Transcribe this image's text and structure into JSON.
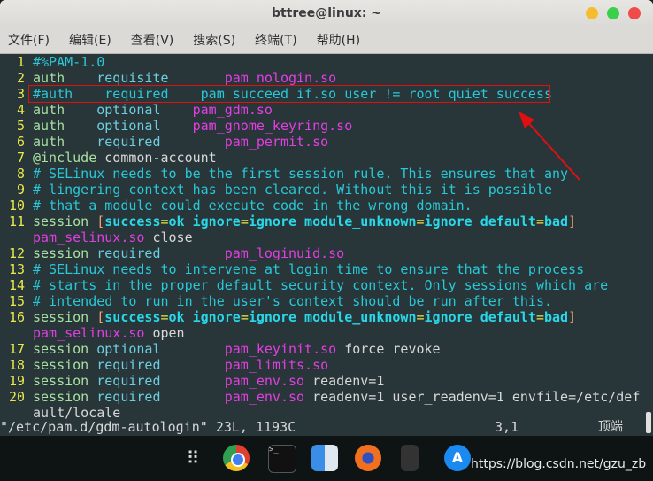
{
  "window": {
    "title": "bttree@linux: ~",
    "buttons": {
      "minimize": "#f5bd2e",
      "maximize": "#3ad04a",
      "close": "#f04a4a"
    }
  },
  "menu": [
    "文件(F)",
    "编辑(E)",
    "查看(V)",
    "搜索(S)",
    "终端(T)",
    "帮助(H)"
  ],
  "editor": {
    "rows": [
      {
        "num": "1",
        "segs": [
          [
            "c",
            "#%PAM-1.0"
          ]
        ]
      },
      {
        "num": "2",
        "segs": [
          [
            "k",
            "auth"
          ],
          [
            "p",
            "    "
          ],
          [
            "t",
            "requisite"
          ],
          [
            "p",
            "       "
          ],
          [
            "m",
            "pam_nologin.so"
          ]
        ]
      },
      {
        "num": "3",
        "segs": [
          [
            "c",
            "#auth    required    pam succeed if.so user != root quiet success"
          ]
        ]
      },
      {
        "num": "4",
        "segs": [
          [
            "k",
            "auth"
          ],
          [
            "p",
            "    "
          ],
          [
            "t",
            "optional"
          ],
          [
            "p",
            "    "
          ],
          [
            "m",
            "pam_gdm.so"
          ]
        ]
      },
      {
        "num": "5",
        "segs": [
          [
            "k",
            "auth"
          ],
          [
            "p",
            "    "
          ],
          [
            "t",
            "optional"
          ],
          [
            "p",
            "    "
          ],
          [
            "m",
            "pam_gnome_keyring.so"
          ]
        ]
      },
      {
        "num": "6",
        "segs": [
          [
            "k",
            "auth"
          ],
          [
            "p",
            "    "
          ],
          [
            "t",
            "required"
          ],
          [
            "p",
            "        "
          ],
          [
            "m",
            "pam_permit.so"
          ]
        ]
      },
      {
        "num": "7",
        "segs": [
          [
            "k",
            "@include"
          ],
          [
            "p",
            " common-account"
          ]
        ]
      },
      {
        "num": "8",
        "segs": [
          [
            "c",
            "# SELinux needs to be the first session rule. This ensures that any"
          ]
        ]
      },
      {
        "num": "9",
        "segs": [
          [
            "c",
            "# lingering context has been cleared. Without this it is possible"
          ]
        ]
      },
      {
        "num": "10",
        "segs": [
          [
            "c",
            "# that a module could execute code in the wrong domain."
          ]
        ]
      },
      {
        "num": "11",
        "segs": [
          [
            "k",
            "session"
          ],
          [
            "p",
            " "
          ],
          [
            "br",
            "["
          ],
          [
            "b",
            "success"
          ],
          [
            "e",
            "="
          ],
          [
            "b",
            "ok ignore"
          ],
          [
            "e",
            "="
          ],
          [
            "b",
            "ignore module_unknown"
          ],
          [
            "e",
            "="
          ],
          [
            "b",
            "ignore default"
          ],
          [
            "e",
            "="
          ],
          [
            "b",
            "bad"
          ],
          [
            "br",
            "]"
          ]
        ]
      },
      {
        "num": "",
        "segs": [
          [
            "m",
            "pam_selinux.so"
          ],
          [
            "p",
            " close"
          ]
        ]
      },
      {
        "num": "12",
        "segs": [
          [
            "k",
            "session"
          ],
          [
            "p",
            " "
          ],
          [
            "t",
            "required"
          ],
          [
            "p",
            "        "
          ],
          [
            "m",
            "pam_loginuid.so"
          ]
        ]
      },
      {
        "num": "13",
        "segs": [
          [
            "c",
            "# SELinux needs to intervene at login time to ensure that the process"
          ]
        ]
      },
      {
        "num": "14",
        "segs": [
          [
            "c",
            "# starts in the proper default security context. Only sessions which are"
          ]
        ]
      },
      {
        "num": "15",
        "segs": [
          [
            "c",
            "# intended to run in the user's context should be run after this."
          ]
        ]
      },
      {
        "num": "16",
        "segs": [
          [
            "k",
            "session"
          ],
          [
            "p",
            " "
          ],
          [
            "br",
            "["
          ],
          [
            "b",
            "success"
          ],
          [
            "e",
            "="
          ],
          [
            "b",
            "ok ignore"
          ],
          [
            "e",
            "="
          ],
          [
            "b",
            "ignore module_unknown"
          ],
          [
            "e",
            "="
          ],
          [
            "b",
            "ignore default"
          ],
          [
            "e",
            "="
          ],
          [
            "b",
            "bad"
          ],
          [
            "br",
            "]"
          ]
        ]
      },
      {
        "num": "",
        "segs": [
          [
            "m",
            "pam_selinux.so"
          ],
          [
            "p",
            " open"
          ]
        ]
      },
      {
        "num": "17",
        "segs": [
          [
            "k",
            "session"
          ],
          [
            "p",
            " "
          ],
          [
            "t",
            "optional"
          ],
          [
            "p",
            "        "
          ],
          [
            "m",
            "pam_keyinit.so"
          ],
          [
            "p",
            " force revoke"
          ]
        ]
      },
      {
        "num": "18",
        "segs": [
          [
            "k",
            "session"
          ],
          [
            "p",
            " "
          ],
          [
            "t",
            "required"
          ],
          [
            "p",
            "        "
          ],
          [
            "m",
            "pam_limits.so"
          ]
        ]
      },
      {
        "num": "19",
        "segs": [
          [
            "k",
            "session"
          ],
          [
            "p",
            " "
          ],
          [
            "t",
            "required"
          ],
          [
            "p",
            "        "
          ],
          [
            "m",
            "pam_env.so"
          ],
          [
            "p",
            " readenv=1"
          ]
        ]
      },
      {
        "num": "20",
        "segs": [
          [
            "k",
            "session"
          ],
          [
            "p",
            " "
          ],
          [
            "t",
            "required"
          ],
          [
            "p",
            "        "
          ],
          [
            "m",
            "pam_env.so"
          ],
          [
            "p",
            " readenv=1 user_readenv=1 envfile=/etc/def"
          ]
        ]
      },
      {
        "num": "",
        "segs": [
          [
            "p",
            "ault/locale"
          ]
        ]
      }
    ]
  },
  "status": {
    "file": "\"/etc/pam.d/gdm-autologin\" 23L, 1193C",
    "position": "3,1",
    "scroll": "顶端"
  },
  "dock": [
    "apps-grid-icon",
    "chrome-icon",
    "terminal-icon",
    "finder-icon",
    "firefox-icon",
    "calculator-icon",
    "app-store-icon"
  ],
  "watermark": "https://blog.csdn.net/gzu_zb"
}
